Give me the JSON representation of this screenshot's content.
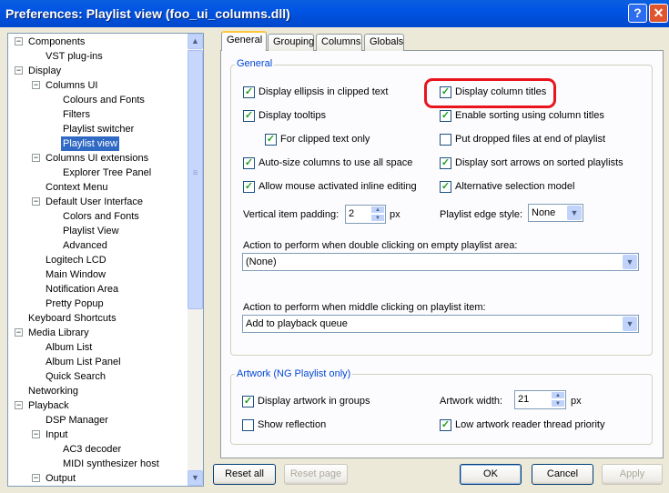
{
  "window": {
    "title": "Preferences: Playlist view (foo_ui_columns.dll)",
    "help": "?",
    "close": "✕"
  },
  "tree": [
    {
      "label": "Components",
      "level": 0,
      "expander": "−"
    },
    {
      "label": "VST plug-ins",
      "level": 1,
      "expander": null
    },
    {
      "label": "Display",
      "level": 0,
      "expander": "−"
    },
    {
      "label": "Columns UI",
      "level": 1,
      "expander": "−"
    },
    {
      "label": "Colours and Fonts",
      "level": 2,
      "expander": null
    },
    {
      "label": "Filters",
      "level": 2,
      "expander": null
    },
    {
      "label": "Playlist switcher",
      "level": 2,
      "expander": null
    },
    {
      "label": "Playlist view",
      "level": 2,
      "expander": null,
      "selected": true
    },
    {
      "label": "Columns UI extensions",
      "level": 1,
      "expander": "−"
    },
    {
      "label": "Explorer Tree Panel",
      "level": 2,
      "expander": null
    },
    {
      "label": "Context Menu",
      "level": 1,
      "expander": null
    },
    {
      "label": "Default User Interface",
      "level": 1,
      "expander": "−"
    },
    {
      "label": "Colors and Fonts",
      "level": 2,
      "expander": null
    },
    {
      "label": "Playlist View",
      "level": 2,
      "expander": null
    },
    {
      "label": "Advanced",
      "level": 2,
      "expander": null
    },
    {
      "label": "Logitech LCD",
      "level": 1,
      "expander": null
    },
    {
      "label": "Main Window",
      "level": 1,
      "expander": null
    },
    {
      "label": "Notification Area",
      "level": 1,
      "expander": null
    },
    {
      "label": "Pretty Popup",
      "level": 1,
      "expander": null
    },
    {
      "label": "Keyboard Shortcuts",
      "level": 0,
      "expander": null
    },
    {
      "label": "Media Library",
      "level": 0,
      "expander": "−"
    },
    {
      "label": "Album List",
      "level": 1,
      "expander": null
    },
    {
      "label": "Album List Panel",
      "level": 1,
      "expander": null
    },
    {
      "label": "Quick Search",
      "level": 1,
      "expander": null
    },
    {
      "label": "Networking",
      "level": 0,
      "expander": null
    },
    {
      "label": "Playback",
      "level": 0,
      "expander": "−"
    },
    {
      "label": "DSP Manager",
      "level": 1,
      "expander": null
    },
    {
      "label": "Input",
      "level": 1,
      "expander": "−"
    },
    {
      "label": "AC3 decoder",
      "level": 2,
      "expander": null
    },
    {
      "label": "MIDI synthesizer host",
      "level": 2,
      "expander": null
    },
    {
      "label": "Output",
      "level": 1,
      "expander": "−"
    }
  ],
  "tabs": [
    "General",
    "Grouping",
    "Columns",
    "Globals"
  ],
  "general": {
    "label": "General",
    "left": [
      {
        "label": "Display ellipsis in clipped text",
        "checked": true
      },
      {
        "label": "Display tooltips",
        "checked": true
      },
      {
        "label": "For clipped text only",
        "checked": true
      },
      {
        "label": "Auto-size columns to use all space",
        "checked": true
      },
      {
        "label": "Allow mouse activated inline editing",
        "checked": true
      }
    ],
    "right": [
      {
        "label": "Display column titles",
        "checked": true
      },
      {
        "label": "Enable sorting using column titles",
        "checked": true
      },
      {
        "label": "Put dropped files at end of playlist",
        "checked": false
      },
      {
        "label": "Display sort arrows on sorted playlists",
        "checked": true
      },
      {
        "label": "Alternative selection model",
        "checked": true
      }
    ],
    "padding_label": "Vertical item padding:",
    "padding_value": "2",
    "padding_unit": "px",
    "edge_label": "Playlist edge style:",
    "edge_value": "None",
    "dbl_label": "Action to perform when double clicking on empty playlist area:",
    "dbl_value": "(None)",
    "mid_label": "Action to perform when middle clicking on playlist item:",
    "mid_value": "Add to playback queue"
  },
  "artwork": {
    "label": "Artwork (NG Playlist only)",
    "groups": {
      "label": "Display artwork in groups",
      "checked": true
    },
    "reflection": {
      "label": "Show reflection",
      "checked": false
    },
    "width_label": "Artwork width:",
    "width_value": "21",
    "width_unit": "px",
    "low": {
      "label": "Low artwork reader thread priority",
      "checked": true
    }
  },
  "buttons": {
    "reset_all": "Reset all",
    "reset_page": "Reset page",
    "ok": "OK",
    "cancel": "Cancel",
    "apply": "Apply"
  },
  "highlight_color": "#E8141E"
}
